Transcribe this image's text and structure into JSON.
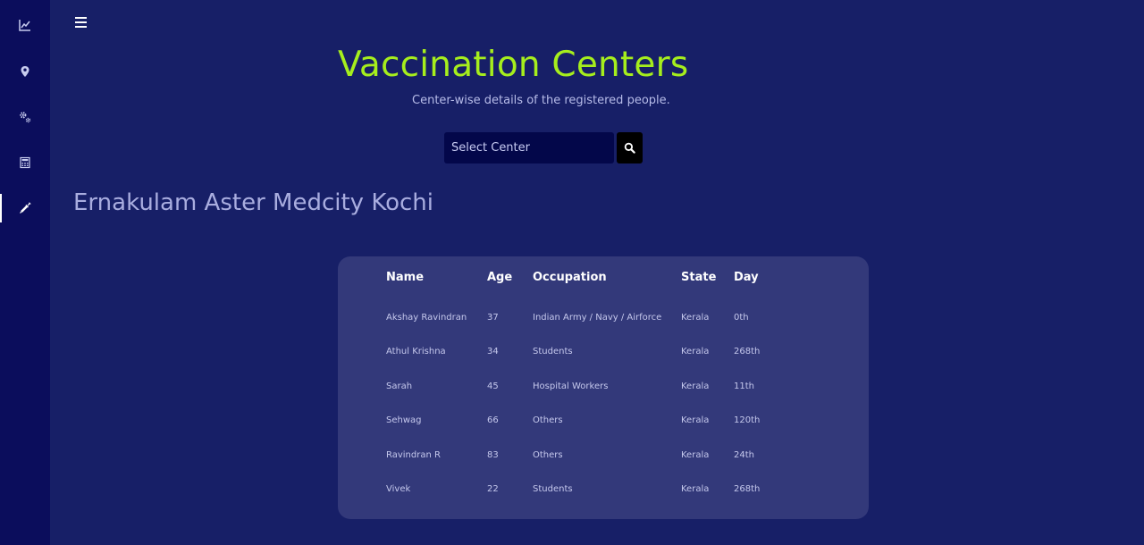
{
  "sidebar": {
    "items": [
      {
        "icon": "chart-line-icon"
      },
      {
        "icon": "map-marker-icon"
      },
      {
        "icon": "gears-icon"
      },
      {
        "icon": "calculator-icon"
      },
      {
        "icon": "syringe-icon",
        "active": true
      }
    ]
  },
  "header": {
    "menu_icon": "hamburger-menu-icon",
    "title": "Vaccination Centers",
    "subtitle": "Center-wise details of the registered people."
  },
  "search": {
    "select_value": "Select Center",
    "button_icon": "search-icon"
  },
  "center": {
    "name": "Ernakulam Aster Medcity Kochi"
  },
  "table": {
    "headers": [
      "Name",
      "Age",
      "Occupation",
      "State",
      "Day"
    ],
    "rows": [
      [
        "Akshay Ravindran",
        "37",
        "Indian Army / Navy / Airforce",
        "Kerala",
        "0th"
      ],
      [
        "Athul Krishna",
        "34",
        "Students",
        "Kerala",
        "268th"
      ],
      [
        "Sarah",
        "45",
        "Hospital Workers",
        "Kerala",
        "11th"
      ],
      [
        "Sehwag",
        "66",
        "Others",
        "Kerala",
        "120th"
      ],
      [
        "Ravindran R",
        "83",
        "Others",
        "Kerala",
        "24th"
      ],
      [
        "Vivek",
        "22",
        "Students",
        "Kerala",
        "268th"
      ]
    ]
  },
  "colors": {
    "background": "#171f67",
    "sidebar": "#0b0d5c",
    "accent_title": "#a6ee1d",
    "card": "#33397a"
  }
}
